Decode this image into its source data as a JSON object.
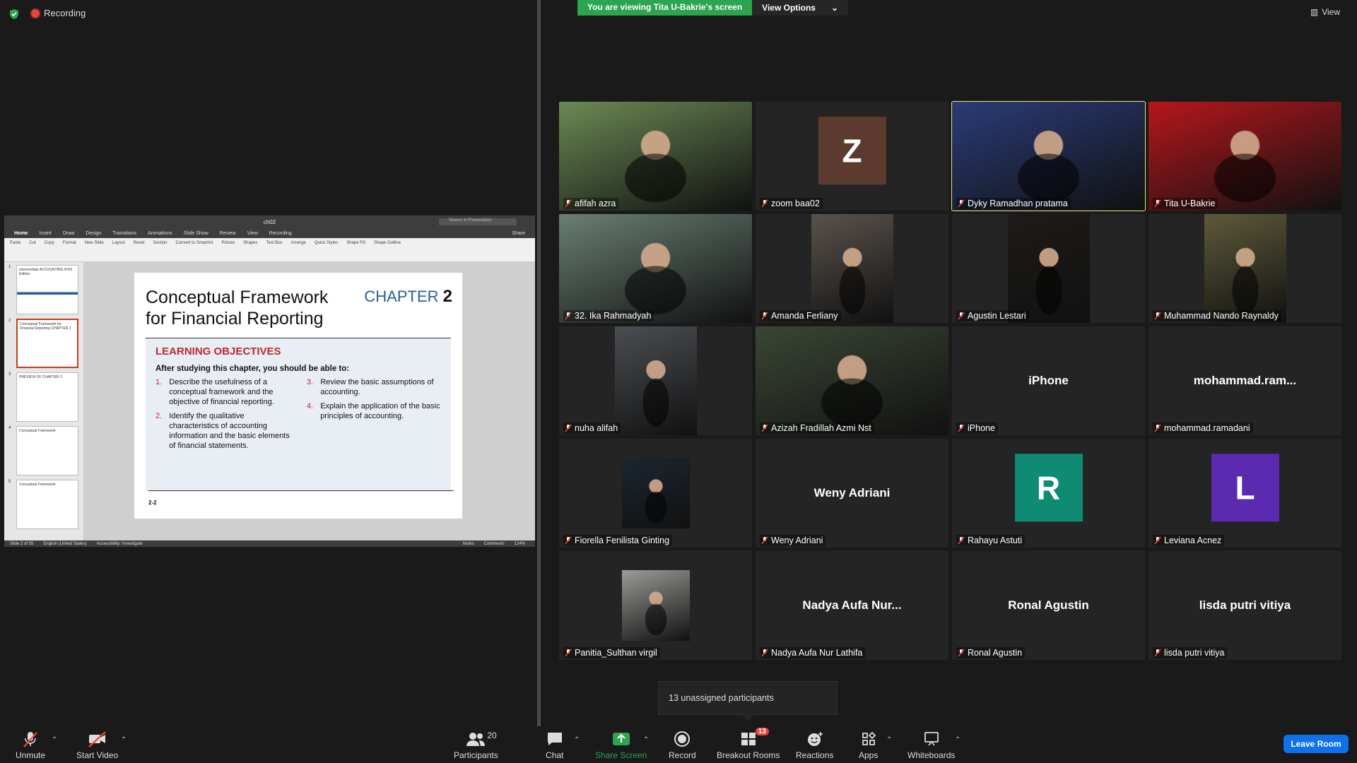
{
  "top": {
    "recording_label": "Recording"
  },
  "banner": {
    "viewing_text": "You are viewing Tita U-Bakrie's screen",
    "view_options": "View Options",
    "view_label": "View"
  },
  "ppt": {
    "file_name": "ch02",
    "search_placeholder": "Search in Presentation",
    "tabs": [
      "Home",
      "Insert",
      "Draw",
      "Design",
      "Transitions",
      "Animations",
      "Slide Show",
      "Review",
      "View",
      "Recording"
    ],
    "share": "Share",
    "ribbon": [
      "Paste",
      "Cut",
      "Copy",
      "Format",
      "New Slide",
      "Layout",
      "Reset",
      "Section",
      "Convert to SmartArt",
      "Picture",
      "Shapes",
      "Text Box",
      "Arrange",
      "Quick Styles",
      "Shape Fill",
      "Shape Outline"
    ],
    "thumbs": [
      {
        "n": "1",
        "text": "Intermediate ACCOUNTING IFRS Edition"
      },
      {
        "n": "2",
        "text": "Conceptual Framework for Financial Reporting CHAPTER 2"
      },
      {
        "n": "3",
        "text": "PREVIEW OF CHAPTER 2"
      },
      {
        "n": "4",
        "text": "Conceptual Framework"
      },
      {
        "n": "5",
        "text": "Conceptual Framework"
      }
    ],
    "status": {
      "slide": "Slide 2 of 55",
      "lang": "English (United States)",
      "access": "Accessibility: Investigate",
      "notes": "Notes",
      "comments": "Comments",
      "zoom": "124%"
    }
  },
  "slide": {
    "title": "Conceptual Framework for Financial Reporting",
    "chapter_word": "CHAPTER",
    "chapter_num": "2",
    "lo_heading": "LEARNING OBJECTIVES",
    "intro": "After studying this chapter, you should be able to:",
    "objectives_left": [
      {
        "num": "1.",
        "text": "Describe the usefulness of a conceptual framework and the objective of financial reporting."
      },
      {
        "num": "2.",
        "text": "Identify the qualitative characteristics of accounting information and the basic elements of financial statements."
      }
    ],
    "objectives_right": [
      {
        "num": "3.",
        "text": "Review the basic assumptions of accounting."
      },
      {
        "num": "4.",
        "text": "Explain the application of the basic principles of accounting."
      }
    ],
    "page": "2-2"
  },
  "participants": [
    {
      "name": "afifah azra",
      "type": "video",
      "color": "#6b8a55"
    },
    {
      "name": "zoom baa02",
      "type": "avatar",
      "letter": "Z",
      "color": "#5c3b2e"
    },
    {
      "name": "Dyky Ramadhan pratama",
      "type": "video",
      "color": "#2a3c78",
      "active": true
    },
    {
      "name": "Tita U-Bakrie",
      "type": "video",
      "color": "#b5171d"
    },
    {
      "name": "32. Ika Rahmadyah",
      "type": "video",
      "color": "#6a7f74"
    },
    {
      "name": "Amanda Ferliany",
      "type": "video-narrow",
      "color": "#5a534c"
    },
    {
      "name": "Agustin Lestari",
      "type": "video-narrow",
      "color": "#1d1b18"
    },
    {
      "name": "Muhammad Nando Raynaldy",
      "type": "video-narrow",
      "color": "#5e5a3a"
    },
    {
      "name": "nuha alifah",
      "type": "video-narrow",
      "color": "#4b4e52"
    },
    {
      "name": "Azizah Fradillah Azmi Nst",
      "type": "video",
      "color": "#3b4636"
    },
    {
      "name": "iPhone",
      "type": "text",
      "big": "iPhone"
    },
    {
      "name": "mohammad.ramadani",
      "type": "text",
      "big": "mohammad.ram..."
    },
    {
      "name": "Fiorella Fenilista Ginting",
      "type": "photo",
      "color": "#1b2630"
    },
    {
      "name": "Weny Adriani",
      "type": "text",
      "big": "Weny Adriani"
    },
    {
      "name": "Rahayu Astuti",
      "type": "avatar",
      "letter": "R",
      "color": "#0f8a73"
    },
    {
      "name": "Leviana Acnez",
      "type": "avatar",
      "letter": "L",
      "color": "#5b2ab0"
    },
    {
      "name": "Panitia_Sulthan virgil",
      "type": "photo",
      "color": "#9a9c98"
    },
    {
      "name": "Nadya Aufa Nur Lathifa",
      "type": "text",
      "big": "Nadya Aufa Nur..."
    },
    {
      "name": "Ronal Agustin",
      "type": "text",
      "big": "Ronal Agustin"
    },
    {
      "name": "lisda putri vitiya",
      "type": "text",
      "big": "lisda putri vitiya"
    }
  ],
  "unassigned": "13 unassigned participants",
  "toolbar": {
    "unmute": "Unmute",
    "start_video": "Start Video",
    "participants": "Participants",
    "participants_count": "20",
    "chat": "Chat",
    "share_screen": "Share Screen",
    "record": "Record",
    "breakout": "Breakout Rooms",
    "breakout_badge": "13",
    "reactions": "Reactions",
    "apps": "Apps",
    "whiteboards": "Whiteboards",
    "leave": "Leave Room"
  },
  "colors": {
    "share_green": "#2da44e",
    "leave_blue": "#0e71eb",
    "active_outline": "#f3e56a",
    "muted_red": "#e8453c"
  }
}
